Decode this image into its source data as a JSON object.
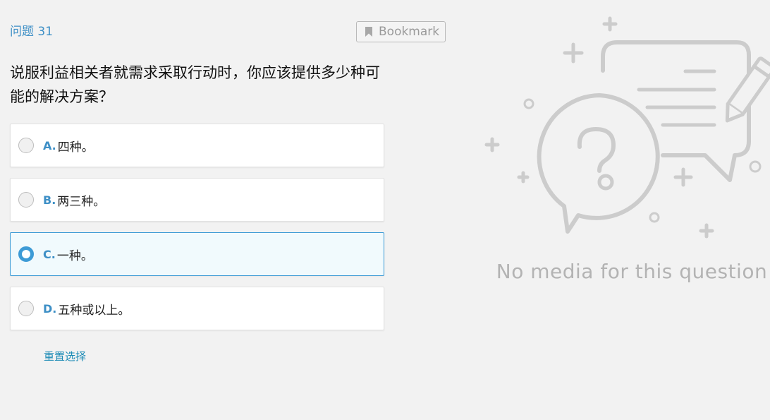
{
  "question_number": "问题 31",
  "bookmark_label": "Bookmark",
  "question_text": "说服利益相关者就需求采取行动时，你应该提供多少种可能的解决方案？",
  "options": [
    {
      "letter": "A.",
      "text": "四种。",
      "selected": false
    },
    {
      "letter": "B.",
      "text": "两三种。",
      "selected": false
    },
    {
      "letter": "C.",
      "text": "一种。",
      "selected": true
    },
    {
      "letter": "D.",
      "text": "五种或以上。",
      "selected": false
    }
  ],
  "reset_label": "重置选择",
  "no_media_text": "No media for this question",
  "colors": {
    "accent": "#3d9bd6",
    "link": "#1a8ab5",
    "illustration": "#cccccc",
    "background": "#f2f2f2"
  },
  "icons": {
    "bookmark": "bookmark-icon",
    "illustration": "question-chat-illustration"
  }
}
